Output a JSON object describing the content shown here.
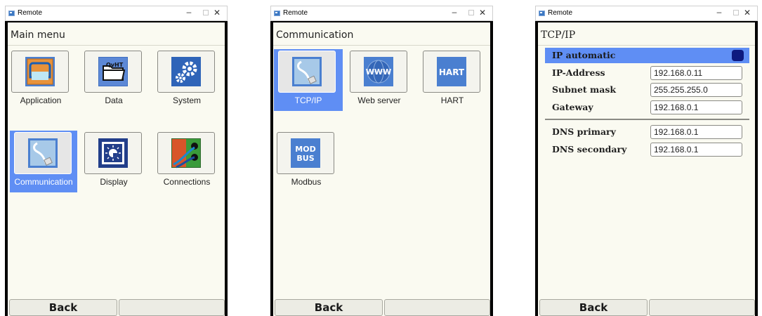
{
  "windows": [
    {
      "title": "Remote",
      "header": "Main menu",
      "tiles": [
        {
          "label": "Application",
          "icon": "application-icon"
        },
        {
          "label": "Data",
          "icon": "data-folder-icon"
        },
        {
          "label": "System",
          "icon": "system-gears-icon"
        },
        {
          "label": "Communication",
          "icon": "communication-cable-icon"
        },
        {
          "label": "Display",
          "icon": "display-brightness-icon"
        },
        {
          "label": "Connections",
          "icon": "connections-wiring-icon"
        }
      ],
      "back": "Back"
    },
    {
      "title": "Remote",
      "header": "Communication",
      "tiles": [
        {
          "label": "TCP/IP",
          "icon": "tcpip-cable-icon"
        },
        {
          "label": "Web server",
          "icon": "www-globe-icon",
          "text": "WWW"
        },
        {
          "label": "HART",
          "icon": "hart-icon",
          "text": "HART"
        },
        {
          "label": "Modbus",
          "icon": "modbus-icon",
          "text1": "MOD",
          "text2": "BUS"
        }
      ],
      "back": "Back"
    },
    {
      "title": "Remote",
      "header": "TCP/IP",
      "ip_automatic": "IP automatic",
      "fields": [
        {
          "label": "IP-Address",
          "value": "192.168.0.11"
        },
        {
          "label": "Subnet mask",
          "value": "255.255.255.0"
        },
        {
          "label": "Gateway",
          "value": "192.168.0.1"
        },
        {
          "label": "DNS primary",
          "value": "192.168.0.1"
        },
        {
          "label": "DNS secondary",
          "value": "192.168.0.1"
        }
      ],
      "back": "Back"
    }
  ],
  "colors": {
    "selection": "#5f8ef4",
    "toggle": "#0d1a80",
    "screen": "#fafaf1"
  }
}
